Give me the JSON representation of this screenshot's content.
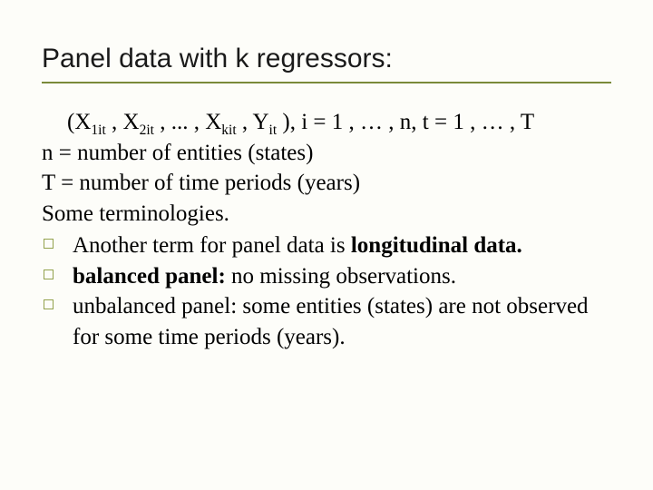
{
  "title": "Panel data with k regressors:",
  "notation": {
    "x1_base": "X",
    "x1_sub": "1it",
    "sep1": " , ",
    "x2_base": "X",
    "x2_sub": "2it",
    "sep2": " , ... , ",
    "xk_base": "X",
    "xk_sub": "kit",
    "sep3": " , ",
    "y_base": "Y",
    "y_sub": "it",
    "tail": " ), i = 1 , … , n, t = 1 , … , T",
    "open": "("
  },
  "lines": {
    "n_def": "n = number of entities (states)",
    "t_def": "T = number of time periods (years)",
    "some": "Some terminologies."
  },
  "bullets": [
    {
      "pre": "Another term for panel data is ",
      "bold": "longitudinal data.",
      "post": ""
    },
    {
      "pre": "",
      "bold": "balanced panel:",
      "post": " no missing observations."
    },
    {
      "pre": "unbalanced panel: some entities (states) are not observed for some time periods (years).",
      "bold": "",
      "post": ""
    }
  ]
}
